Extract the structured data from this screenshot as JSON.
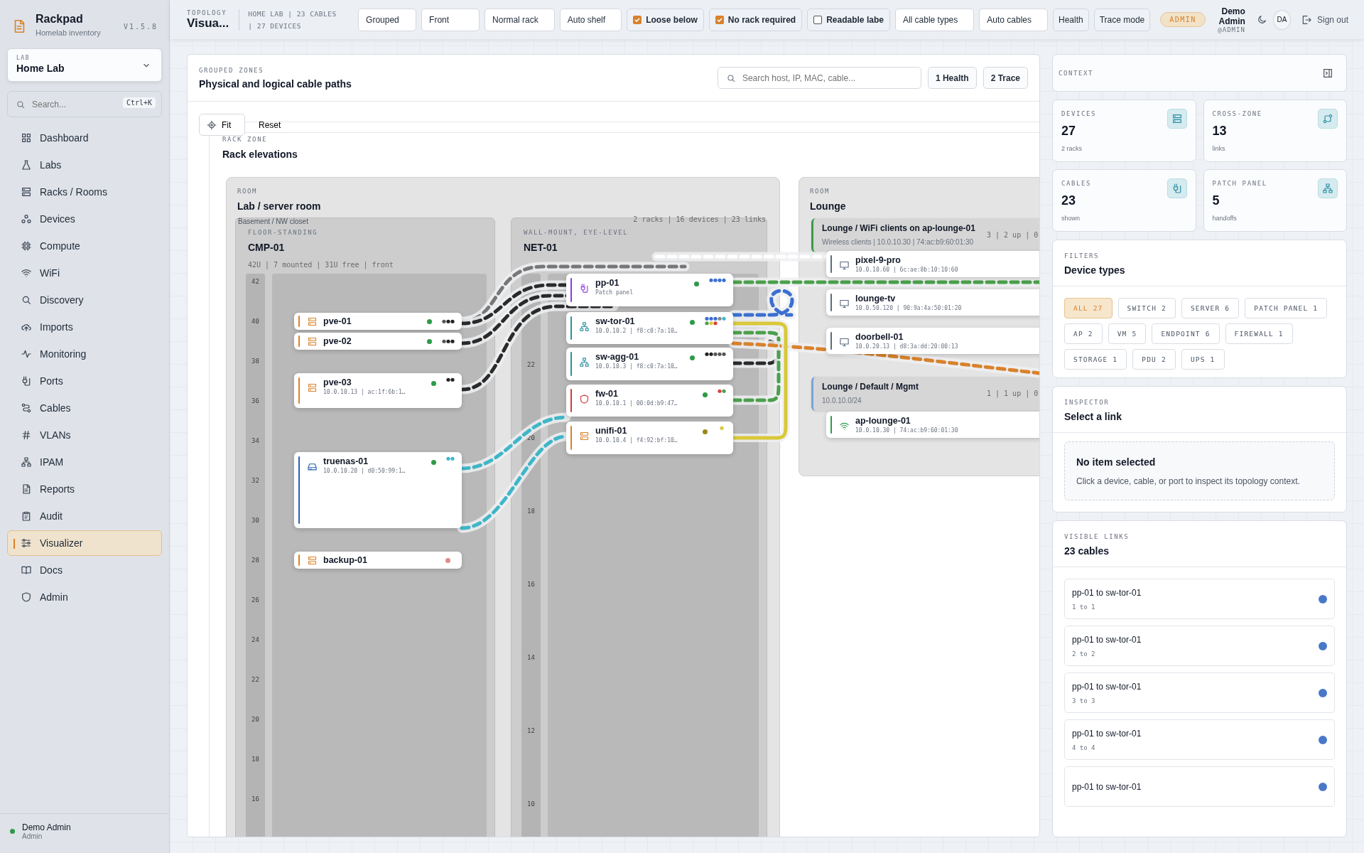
{
  "sidebar": {
    "app_name": "Rackpad",
    "subtitle": "Homelab inventory",
    "version": "V1.5.8",
    "lab": {
      "label": "LAB",
      "value": "Home Lab"
    },
    "search": {
      "placeholder": "Search...",
      "shortcut": "Ctrl+K"
    },
    "items": [
      {
        "label": "Dashboard",
        "selected": false
      },
      {
        "label": "Labs",
        "selected": false
      },
      {
        "label": "Racks / Rooms",
        "selected": false
      },
      {
        "label": "Devices",
        "selected": false
      },
      {
        "label": "Compute",
        "selected": false
      },
      {
        "label": "WiFi",
        "selected": false
      },
      {
        "label": "Discovery",
        "selected": false
      },
      {
        "label": "Imports",
        "selected": false
      },
      {
        "label": "Monitoring",
        "selected": false
      },
      {
        "label": "Ports",
        "selected": false
      },
      {
        "label": "Cables",
        "selected": false
      },
      {
        "label": "VLANs",
        "selected": false
      },
      {
        "label": "IPAM",
        "selected": false
      },
      {
        "label": "Reports",
        "selected": false
      },
      {
        "label": "Audit",
        "selected": false
      },
      {
        "label": "Visualizer",
        "selected": true
      },
      {
        "label": "Docs",
        "selected": false
      },
      {
        "label": "Admin",
        "selected": false
      }
    ],
    "user": {
      "name": "Demo Admin",
      "role": "Admin",
      "color": "#2e9a48"
    }
  },
  "topbar": {
    "section": "TOPOLOGY",
    "title": "Visua...",
    "summary": "HOME LAB | 23 CABLES | 27 DEVICES",
    "controls": [
      {
        "kind": "select",
        "label": "Grouped"
      },
      {
        "kind": "select",
        "label": "Front"
      },
      {
        "kind": "select",
        "label": "Normal rack"
      },
      {
        "kind": "select",
        "label": "Auto shelf"
      },
      {
        "kind": "checkbox",
        "label": "Loose below",
        "checked": true
      },
      {
        "kind": "checkbox",
        "label": "No rack required",
        "checked": true
      },
      {
        "kind": "checkbox",
        "label": "Readable labe",
        "checked": false
      },
      {
        "kind": "select",
        "label": "All cable types"
      },
      {
        "kind": "select",
        "label": "Auto cables"
      },
      {
        "kind": "button",
        "label": "Health"
      },
      {
        "kind": "button",
        "label": "Trace mode"
      }
    ],
    "role_badge": "ADMIN",
    "user": {
      "name": "Demo Admin",
      "handle": "@ADMIN",
      "initials": "DA"
    },
    "sign_out": "Sign out"
  },
  "canvas": {
    "eyebrow": "GROUPED ZONES",
    "title": "Physical and logical cable paths",
    "search": {
      "placeholder": "Search host, IP, MAC, cable..."
    },
    "actions": [
      "1 Health",
      "2 Trace"
    ],
    "tools": [
      "Fit",
      "Reset"
    ],
    "zone": {
      "eyebrow": "RACK ZONE",
      "title": "Rack elevations"
    },
    "server_room": {
      "eyebrow": "ROOM",
      "title": "Lab / server room",
      "location": "Basement / NW closet",
      "stats": "2 racks | 16 devices | 23 links",
      "racks": [
        {
          "mount": "FLOOR-STANDING",
          "name": "CMP-01",
          "stats": "42U | 7 mounted | 31U free | front",
          "units": [
            "42",
            "40",
            "38",
            "36",
            "34",
            "32",
            "30",
            "28",
            "26",
            "24",
            "22",
            "20",
            "18",
            "16"
          ],
          "devices": [
            {
              "name": "pve-01",
              "kind": "server",
              "color": "#2e9a48",
              "ports": [
                {
                  "color": "#555555"
                },
                {
                  "color": "#222222"
                },
                {
                  "color": "#222222"
                }
              ]
            },
            {
              "name": "pve-02",
              "kind": "server",
              "color": "#2e9a48",
              "ports": [
                {
                  "color": "#555555"
                },
                {
                  "color": "#222222"
                },
                {
                  "color": "#222222"
                }
              ]
            },
            {
              "name": "pve-03",
              "kind": "server",
              "detail": "10.0.10.13 | ac:1f:6b:1…",
              "color": "#2e9a48",
              "ports": [
                {
                  "color": "#222222"
                },
                {
                  "color": "#222222"
                }
              ]
            },
            {
              "name": "truenas-01",
              "kind": "storage",
              "detail": "10.0.10.20 | d0:50:99:1…",
              "color": "#2e9a48",
              "ports": [
                {
                  "color": "#3fb6c8"
                },
                {
                  "color": "#3fb6c8"
                }
              ]
            },
            {
              "name": "backup-01",
              "kind": "server",
              "color": "#e08a8a"
            }
          ]
        },
        {
          "mount": "WALL-MOUNT, EYE-LEVEL",
          "name": "NET-01",
          "units": [
            "22",
            "20",
            "18",
            "16",
            "14",
            "12",
            "10"
          ],
          "devices": [
            {
              "name": "pp-01",
              "kind": "patch",
              "detail": "Patch panel",
              "color": "#2e9a48",
              "ports": [
                {
                  "color": "#3a6fd0"
                },
                {
                  "color": "#3a6fd0"
                },
                {
                  "color": "#3a6fd0"
                },
                {
                  "color": "#3a6fd0"
                }
              ]
            },
            {
              "name": "sw-tor-01",
              "kind": "switch",
              "detail": "10.0.10.2 | f8:c0:7a:10…",
              "color": "#2e9a48",
              "ports": [
                {
                  "color": "#3a6fd0"
                },
                {
                  "color": "#3a6fd0"
                },
                {
                  "color": "#3a6fd0"
                },
                {
                  "color": "#888888"
                },
                {
                  "color": "#3fb6c8"
                },
                {
                  "color": "#4aa04a"
                },
                {
                  "color": "#d9c83a"
                },
                {
                  "color": "#d94040"
                }
              ]
            },
            {
              "name": "sw-agg-01",
              "kind": "switch",
              "detail": "10.0.10.3 | f8:c0:7a:10…",
              "color": "#2e9a48",
              "ports": [
                {
                  "color": "#222222"
                },
                {
                  "color": "#222222"
                },
                {
                  "color": "#555555"
                },
                {
                  "color": "#555555"
                },
                {
                  "color": "#555555"
                }
              ]
            },
            {
              "name": "fw-01",
              "kind": "firewall",
              "detail": "10.0.10.1 | 00:0d:b9:47…",
              "color": "#2e9a48",
              "ports": [
                {
                  "color": "#d94040"
                },
                {
                  "color": "#4aa04a"
                }
              ]
            },
            {
              "name": "unifi-01",
              "kind": "server",
              "detail": "10.0.10.4 | f4:92:bf:10…",
              "color": "#9a8a1a",
              "ports": [
                {
                  "color": "#d9c83a"
                }
              ]
            }
          ]
        }
      ]
    },
    "lounge": {
      "eyebrow": "ROOM",
      "title": "Lounge",
      "groups": [
        {
          "title": "Lounge / WiFi clients on ap-lounge-01",
          "subtitle": "Wireless clients | 10.0.10.30 | 74:ac:b9:60:01:30",
          "stats": "3 | 2 up | 0",
          "color": "#3a9a4a",
          "devices": [
            {
              "name": "pixel-9-pro",
              "kind": "endpoint",
              "detail": "10.0.10.60 | 6c:ae:8b:10:10:60"
            },
            {
              "name": "lounge-tv",
              "kind": "endpoint",
              "detail": "10.0.50.120 | 90:9a:4a:50:01:20"
            },
            {
              "name": "doorbell-01",
              "kind": "endpoint",
              "detail": "10.0.20.13 | d8:3a:dd:20:00:13"
            }
          ]
        },
        {
          "title": "Lounge / Default / Mgmt",
          "subtitle": "10.0.10.0/24",
          "stats": "1 | 1 up | 0",
          "color": "#7ba3dc",
          "devices": [
            {
              "name": "ap-lounge-01",
              "kind": "ap",
              "detail": "10.0.10.30 | 74:ac:b9:60:01:30"
            }
          ]
        }
      ]
    }
  },
  "context": {
    "title": "CONTEXT",
    "stats": [
      {
        "label": "DEVICES",
        "value": "27",
        "note": "2 racks"
      },
      {
        "label": "CROSS-ZONE",
        "value": "13",
        "note": "links"
      },
      {
        "label": "CABLES",
        "value": "23",
        "note": "shown"
      },
      {
        "label": "PATCH PANEL",
        "value": "5",
        "note": "handoffs"
      }
    ]
  },
  "filters": {
    "eyebrow": "FILTERS",
    "title": "Device types",
    "chips": [
      {
        "label": "ALL 27",
        "selected": true
      },
      {
        "label": "SWITCH 2",
        "selected": false
      },
      {
        "label": "SERVER 6",
        "selected": false
      },
      {
        "label": "PATCH PANEL 1",
        "selected": false
      },
      {
        "label": "AP 2",
        "selected": false
      },
      {
        "label": "VM 5",
        "selected": false
      },
      {
        "label": "ENDPOINT 6",
        "selected": false
      },
      {
        "label": "FIREWALL 1",
        "selected": false
      },
      {
        "label": "STORAGE 1",
        "selected": false
      },
      {
        "label": "PDU 2",
        "selected": false
      },
      {
        "label": "UPS 1",
        "selected": false
      }
    ]
  },
  "inspector": {
    "eyebrow": "INSPECTOR",
    "title": "Select a link",
    "empty_title": "No item selected",
    "empty_text": "Click a device, cable, or port to inspect its topology context."
  },
  "links": {
    "eyebrow": "VISIBLE LINKS",
    "title": "23 cables",
    "items": [
      {
        "title": "pp-01 to sw-tor-01",
        "ports": "1 to 1",
        "color": "#4a78c8"
      },
      {
        "title": "pp-01 to sw-tor-01",
        "ports": "2 to 2",
        "color": "#4a78c8"
      },
      {
        "title": "pp-01 to sw-tor-01",
        "ports": "3 to 3",
        "color": "#4a78c8"
      },
      {
        "title": "pp-01 to sw-tor-01",
        "ports": "4 to 4",
        "color": "#4a78c8"
      },
      {
        "title": "pp-01 to sw-tor-01",
        "color": "#4a78c8"
      }
    ]
  }
}
